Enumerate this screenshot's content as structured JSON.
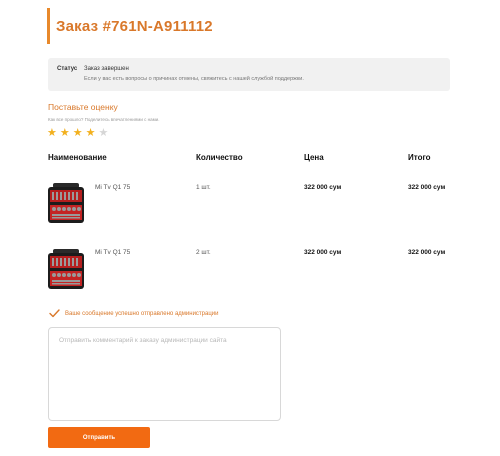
{
  "order": {
    "title": "Заказ #761N-A911112"
  },
  "status": {
    "label": "Статус",
    "value": "Заказ завершен",
    "note": "Если у вас есть вопросы о причинах отмены, свяжитесь с нашей службой поддержки."
  },
  "rating": {
    "title": "Поставьте оценку",
    "subtitle": "Как все прошло? Поделитесь впечатлениями с нами.",
    "value": 4,
    "max": 5,
    "star_color": "#f2b01e"
  },
  "table": {
    "headers": [
      "Наименование",
      "Количество",
      "Цена",
      "Итого"
    ],
    "rows": [
      {
        "image_icon": "toolbox-icon",
        "name": "Mi Tv Q1 75",
        "quantity": "1 шт.",
        "price": "322 000 сум",
        "total": "322 000 сум"
      },
      {
        "image_icon": "toolbox-icon",
        "name": "Mi Tv Q1 75",
        "quantity": "2 шт.",
        "price": "322 000 сум",
        "total": "322 000 сум"
      }
    ]
  },
  "feedback": {
    "success": "Ваше сообщение успешно отправлено администрации",
    "placeholder": "Отправить комментарий к заказу администрации сайта",
    "submit_label": "Отправить"
  },
  "colors": {
    "accent": "#d9782a",
    "button": "#f26a12"
  }
}
